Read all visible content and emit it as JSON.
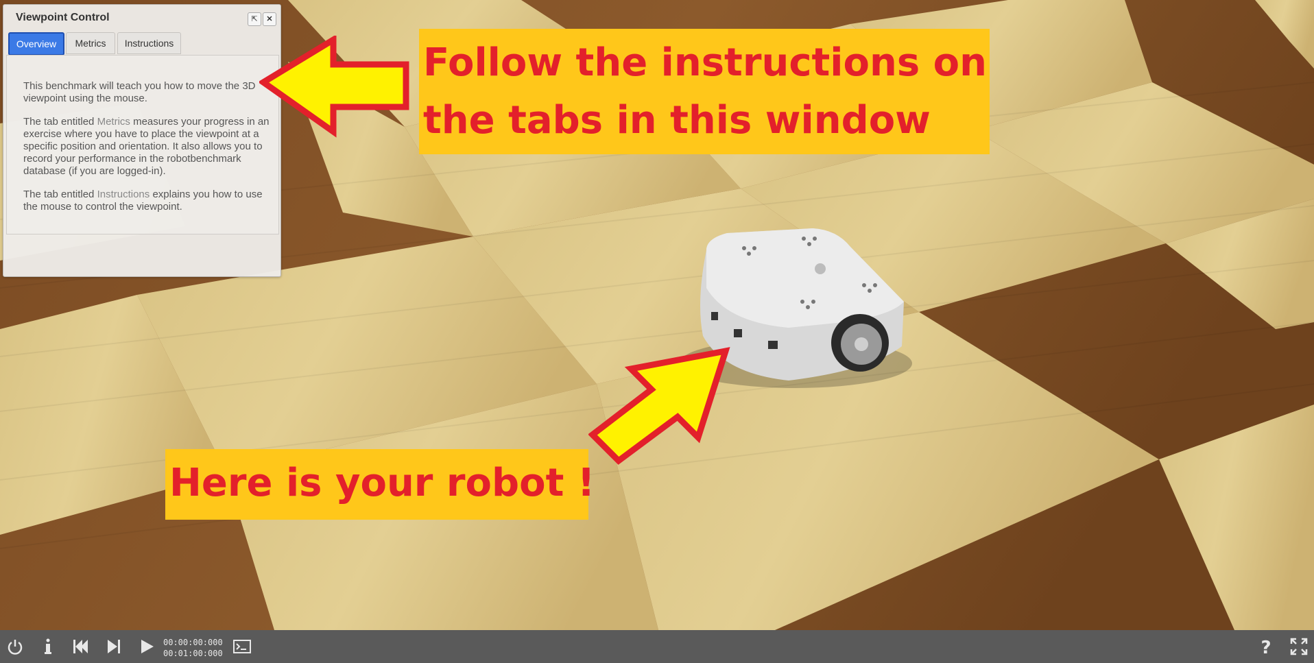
{
  "panel": {
    "title": "Viewpoint Control",
    "tabs": [
      {
        "label": "Overview",
        "active": true
      },
      {
        "label": "Metrics",
        "active": false
      },
      {
        "label": "Instructions",
        "active": false
      }
    ],
    "overview": {
      "p1": "This benchmark will teach you how to move the 3D viewpoint using the mouse.",
      "p2_pre": "The tab entitled ",
      "p2_link": "Metrics",
      "p2_post": " measures your progress in an exercise where you have to place the viewpoint at a specific position and orientation. It also allows you to record your performance in the robotbenchmark database (if you are logged-in).",
      "p3_pre": "The tab entitled ",
      "p3_link": "Instructions",
      "p3_post": " explains you how to use the mouse to control the viewpoint."
    }
  },
  "callouts": {
    "top_line1": "Follow the instructions on",
    "top_line2": "the tabs in this window",
    "bottom": "Here is your robot !"
  },
  "toolbar": {
    "time_current": "00:00:00:000",
    "time_total": "00:01:00:000",
    "icons": [
      "power-icon",
      "info-icon",
      "reset-icon",
      "step-icon",
      "play-icon",
      "console-icon",
      "help-icon",
      "fullscreen-icon"
    ]
  },
  "colors": {
    "callout_bg": "#ffc71a",
    "callout_text": "#e3202b",
    "arrow_fill": "#fff200",
    "arrow_stroke": "#e3202b",
    "tab_active": "#3b7ae6",
    "toolbar_bg": "#5a5a5a"
  }
}
